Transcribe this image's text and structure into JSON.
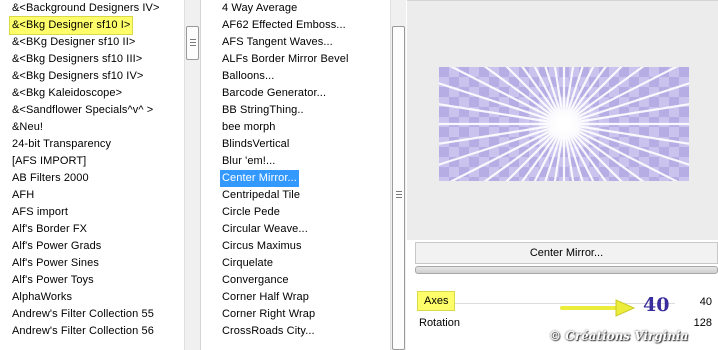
{
  "categories": {
    "items": [
      "&<Background Designers IV>",
      "&<Bkg Designer sf10 I>",
      "&<BKg Designer sf10 II>",
      "&<Bkg Designers sf10 III>",
      "&<Bkg Designers sf10 IV>",
      "&<Bkg Kaleidoscope>",
      "&<Sandflower Specials^v^ >",
      "&Neu!",
      "24-bit Transparency",
      "[AFS IMPORT]",
      "AB Filters 2000",
      "AFH",
      "AFS import",
      "Alf's Border FX",
      "Alf's Power Grads",
      "Alf's Power Sines",
      "Alf's Power Toys",
      "AlphaWorks",
      "Andrew's Filter Collection 55",
      "Andrew's Filter Collection 56"
    ],
    "highlighted_index": 1
  },
  "filters": {
    "items": [
      "4 Way Average",
      "AF62 Effected Emboss...",
      "AFS Tangent Waves...",
      "ALFs Border Mirror Bevel",
      "Balloons...",
      "Barcode Generator...",
      "BB StringThing..",
      "bee morph",
      "BlindsVertical",
      "Blur 'em!...",
      "Center Mirror...",
      "Centripedal Tile",
      "Circle Pede",
      "Circular Weave...",
      "Circus Maximus",
      "Cirquelate",
      "Convergance",
      "Corner Half Wrap",
      "Corner Right Wrap",
      "CrossRoads City..."
    ],
    "selected_index": 10
  },
  "preview": {
    "filter_button_label": "Center Mirror...",
    "ray_color": "#ffffff",
    "background_color": "#c9c3ee",
    "check_color": "#a99fdc"
  },
  "params": {
    "axes_label": "Axes",
    "axes_value": "40",
    "rotation_label": "Rotation",
    "rotation_value": "128"
  },
  "annotation": {
    "big_value": "40",
    "arrow_color": "#ecec3a"
  },
  "watermark": "© Créations Virginia"
}
